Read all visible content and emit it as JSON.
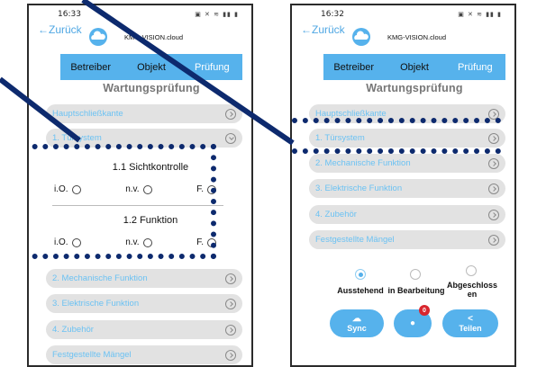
{
  "left": {
    "status_time": "16:33",
    "status_icons": "▣ ✕ ≋ ▮▮ ▮",
    "back_label": "Zurück",
    "brand": "KMG-VISION.cloud",
    "tabs": [
      "Betreiber",
      "Objekt",
      "Prüfung"
    ],
    "active_tab": "Prüfung",
    "section_title": "Wartungsprüfung",
    "items": [
      "Hauptschließkante",
      "1. Türsystem",
      "2. Mechanische Funktion",
      "3. Elektrische Funktion",
      "4. Zubehör",
      "Festgestellte Mängel"
    ],
    "sub_sections": [
      {
        "title": "1.1 Sichtkontrolle",
        "options": [
          "i.O.",
          "n.v.",
          "F."
        ]
      },
      {
        "title": "1.2 Funktion",
        "options": [
          "i.O.",
          "n.v.",
          "F."
        ]
      }
    ]
  },
  "right": {
    "status_time": "16:32",
    "status_icons": "▣ ✕ ≋ ▮▮ ▮",
    "back_label": "Zurück",
    "brand": "KMG-VISION.cloud",
    "tabs": [
      "Betreiber",
      "Objekt",
      "Prüfung"
    ],
    "active_tab": "Prüfung",
    "section_title": "Wartungsprüfung",
    "items": [
      "Hauptschließkante",
      "1. Türsystem",
      "2. Mechanische Funktion",
      "3. Elektrische Funktion",
      "4. Zubehör",
      "Festgestellte Mängel"
    ],
    "status_options": [
      "Ausstehend",
      "in Bearbeitung",
      "Abgeschlossen"
    ],
    "selected_status": "Ausstehend",
    "buttons": {
      "sync": "Sync",
      "share": "Teilen",
      "chat_badge": "0"
    }
  },
  "colors": {
    "accent": "#56b2ec",
    "item_text": "#6cc2f3",
    "highlight": "#0d2a6e",
    "badge": "#d9262e"
  }
}
